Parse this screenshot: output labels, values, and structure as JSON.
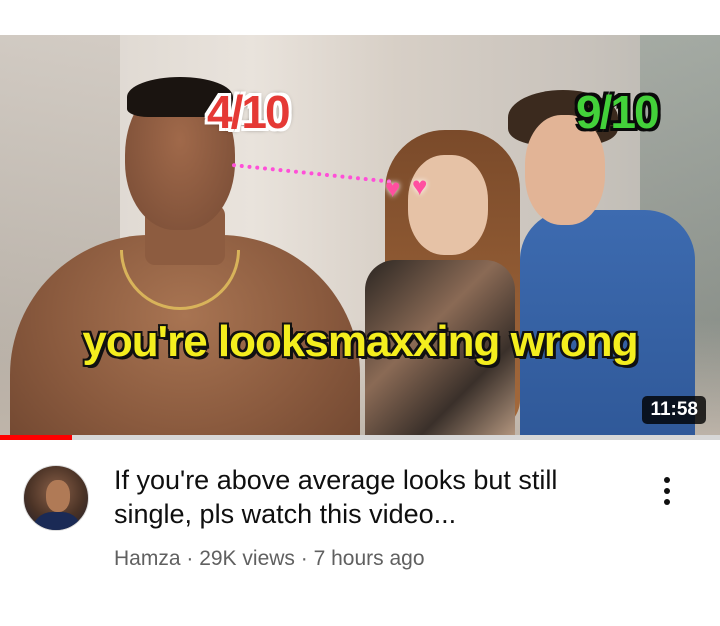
{
  "video": {
    "thumbnail": {
      "rating_left": "4/10",
      "rating_right": "9/10",
      "caption": "you're looksmaxxing wrong",
      "duration": "11:58",
      "progress_fraction": 0.1
    },
    "title": "If you're above average looks but still single, pls watch this video...",
    "channel": "Hamza",
    "views": "29K views",
    "age": "7 hours ago",
    "separator": " · "
  },
  "icons": {
    "more": "vertical-ellipsis-icon",
    "heart": "heart-icon"
  },
  "colors": {
    "progress": "#ff0000",
    "rating_left": "#e53935",
    "rating_right": "#43d13a",
    "caption": "#f4ee1e",
    "dotted_line": "#ff4fd8"
  }
}
